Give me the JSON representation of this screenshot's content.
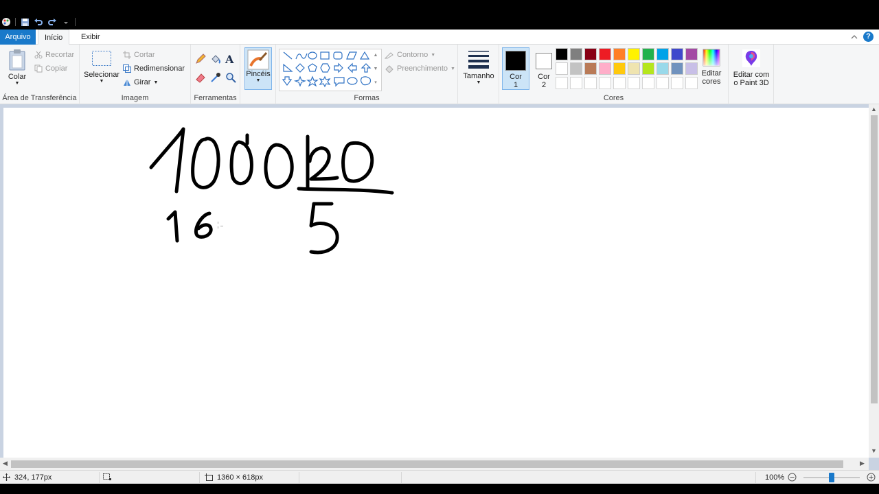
{
  "app": {
    "title": ""
  },
  "menu": {
    "file_tab": "Arquivo",
    "tabs": [
      {
        "label": "Início"
      },
      {
        "label": "Exibir"
      }
    ]
  },
  "clipboard": {
    "paste_label": "Colar",
    "cut_label": "Recortar",
    "copy_label": "Copiar",
    "group_label": "Área de Transferência"
  },
  "image": {
    "select_label": "Selecionar",
    "crop_label": "Cortar",
    "resize_label": "Redimensionar",
    "rotate_label": "Girar",
    "group_label": "Imagem"
  },
  "tools": {
    "group_label": "Ferramentas"
  },
  "brushes": {
    "label": "Pincéis"
  },
  "shapes": {
    "outline_label": "Contorno",
    "fill_label": "Preenchimento",
    "group_label": "Formas"
  },
  "size": {
    "label": "Tamanho"
  },
  "colors": {
    "color1_label_line1": "Cor",
    "color1_label_line2": "1",
    "color2_label_line1": "Cor",
    "color2_label_line2": "2",
    "color1_value": "#000000",
    "color2_value": "#ffffff",
    "edit_colors_line1": "Editar",
    "edit_colors_line2": "cores",
    "group_label": "Cores",
    "palette_row1": [
      "#000000",
      "#7f7f7f",
      "#880015",
      "#ed1c24",
      "#ff7f27",
      "#fff200",
      "#22b14c",
      "#00a2e8",
      "#3f48cc",
      "#a349a4"
    ],
    "palette_row2": [
      "#ffffff",
      "#c3c3c3",
      "#b97a57",
      "#ffaec9",
      "#ffc90e",
      "#efe4b0",
      "#b5e61d",
      "#99d9ea",
      "#7092be",
      "#c8bfe7"
    ]
  },
  "paint3d": {
    "label_line1": "Editar com",
    "label_line2": "o Paint 3D"
  },
  "status": {
    "cursor_position": "324, 177px",
    "canvas_size": "1360 × 618px",
    "zoom_level": "100%",
    "zoom_value": 0.5
  }
}
